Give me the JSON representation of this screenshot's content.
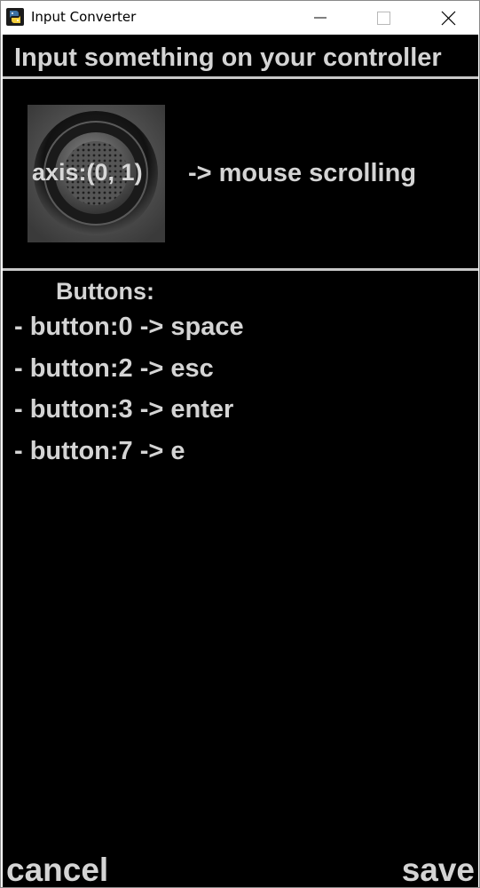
{
  "window": {
    "title": "Input Converter"
  },
  "header": {
    "prompt": "Input something on your controller"
  },
  "axis": {
    "icon": "joystick-icon",
    "label": "axis:(0, 1)",
    "action": "-> mouse scrolling"
  },
  "buttons": {
    "heading": "Buttons:",
    "items": [
      "- button:0 -> space",
      "- button:2 -> esc",
      "- button:3 -> enter",
      "- button:7 -> e"
    ]
  },
  "footer": {
    "cancel_label": "cancel",
    "save_label": "save"
  },
  "colors": {
    "background": "#000000",
    "text": "#d4d4d4",
    "divider": "#c8c8c8"
  }
}
